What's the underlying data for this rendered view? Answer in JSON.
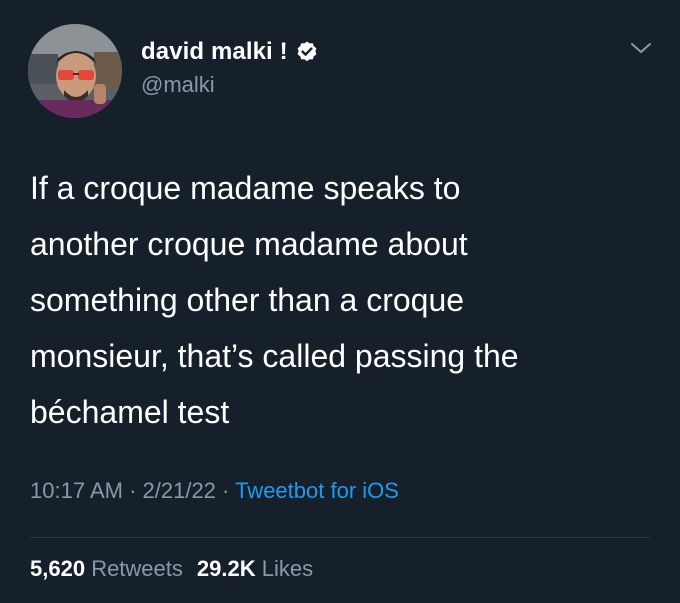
{
  "author": {
    "display_name": "david malki !",
    "handle": "@malki",
    "verified": true
  },
  "icons": {
    "verified": "verified-badge-icon",
    "menu": "chevron-down-icon"
  },
  "tweet": {
    "lines": [
      "If a croque madame speaks to",
      "another croque madame about",
      "something other than a croque",
      "monsieur, that’s called passing the",
      "béchamel test"
    ]
  },
  "meta": {
    "time": "10:17 AM",
    "sep1": " · ",
    "date": "2/21/22",
    "sep2": " · ",
    "source": "Tweetbot for iOS"
  },
  "stats": {
    "retweets_count": "5,620",
    "retweets_label": "Retweets",
    "likes_count": "29.2K",
    "likes_label": "Likes"
  },
  "colors": {
    "background": "#15202b",
    "text": "#ffffff",
    "secondary": "#8b98a5",
    "link": "#1d9bf0"
  }
}
